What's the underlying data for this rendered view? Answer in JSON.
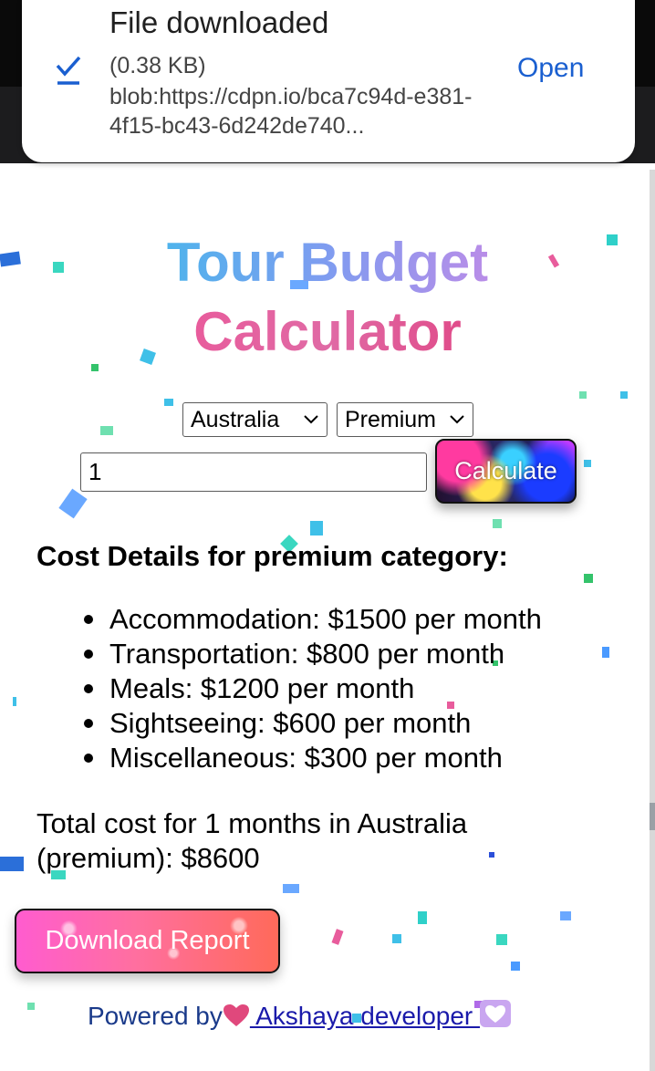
{
  "notification": {
    "title": "File downloaded",
    "size": "(0.38 KB)",
    "url": "blob:https://cdpn.io/bca7c94d-e381-4f15-bc43-6d242de740...",
    "open_label": "Open"
  },
  "app": {
    "title_line1": "Tour Budget",
    "title_line2": "Calculator",
    "destination_selected": "Australia",
    "category_selected": "Premium",
    "months_value": "1",
    "calculate_label": "Calculate",
    "download_label": "Download Report"
  },
  "results": {
    "heading": "Cost Details for premium category:",
    "items": [
      "Accommodation: $1500 per month",
      "Transportation: $800 per month",
      "Meals: $1200 per month",
      "Sightseeing: $600 per month",
      "Miscellaneous: $300 per month"
    ],
    "total": "Total cost for 1 months in Australia (premium): $8600"
  },
  "footer": {
    "prefix": "Powered by",
    "link_text": " Akshaya developer "
  },
  "colors": {
    "open_link": "#1a5fd0",
    "title_blue": "#4fb3ec",
    "title_pink": "#e85c9c",
    "footer_text": "#1a3a8a"
  },
  "icons": [
    "check-icon",
    "chevron-down-icon",
    "heart-icon"
  ]
}
